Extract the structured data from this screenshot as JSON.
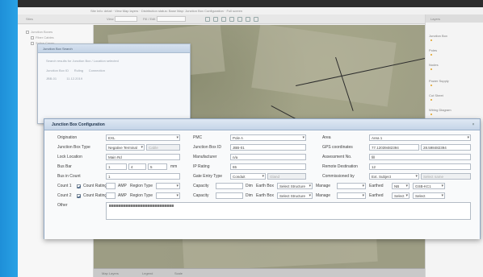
{
  "window": {
    "title_text": "Site Info: detail · View Map layers · Distribution status: Base Map: Junction Box Configuration · Full screen"
  },
  "menubar": {
    "items": [
      "Sites",
      "View",
      "Fill / Edit"
    ]
  },
  "left_panel": {
    "items": [
      "Junction Boxes",
      "Fiber Cables",
      "Splice Cases"
    ]
  },
  "small_dialog": {
    "title": "Junction Box Search",
    "search_text": "Search results for Junction Box / Location selected",
    "columns": [
      "Junction Box ID",
      "Ruling",
      "Connection"
    ],
    "row": [
      "JBB-01",
      "11.12.2019",
      ""
    ]
  },
  "right_panel": {
    "header": "Layers",
    "items": [
      "Junction Box",
      "Poles",
      "Nodes",
      "Power Supply",
      "Cut Sheet",
      "Wiring Diagram"
    ]
  },
  "dialog": {
    "title": "Junction Box Configuration",
    "labels": {
      "origination": "Origination",
      "jb_type": "Junction Box Type",
      "location": "Lock Location",
      "bus_bar": "Bus Bar",
      "bus_count": "Bus in Count",
      "count_row1": "Count 1",
      "count_row2": "Count 2",
      "other": "Other",
      "pmc": "PMC",
      "jb_id": "Junction Box ID",
      "manufacturer": "Manufacturer",
      "ip_rating": "IP Rating",
      "gate_entry_type": "Gate Entry Type",
      "capacity_1": "Capacity",
      "capacity_2": "Capacity",
      "dim_1": "Dim",
      "dim_2": "Dim",
      "earth_box_1": "Earth Box",
      "earth_box_2": "Earth Box",
      "area": "Area",
      "gps": "GPS coordinates",
      "assessment_no": "Assessment No.",
      "remote_destination": "Remote Destination",
      "commissioned_by": "Commissioned by",
      "manage_1": "Manage",
      "manage_2": "Manage",
      "earthed_1": "Earthed",
      "earthed_2": "Earthed",
      "mm": "mm",
      "nnm": "NNM",
      "count_rating": "Count Rating",
      "ampere": "AMP",
      "region_type": "Region Type"
    },
    "values": {
      "origination": "EXL",
      "jb_type": "Negative Terminal",
      "jb_type_extra": "Cable",
      "location": "Main Rd",
      "bus_bar_1": "1",
      "bus_bar_2": "4",
      "bus_bar_3": "5",
      "bus_count": "1",
      "pmc": "Pole A",
      "jb_id": "JBB-01",
      "manufacturer": "n/a",
      "ip_rating": "65",
      "gate_entry_type": "Conduit",
      "gate_entry_extra": "Gland",
      "area": "Area 1",
      "gps_lat": "77.12039482394",
      "gps_lon": "28.598482394",
      "assessment_no": "fill",
      "remote_destination": "12",
      "commissioned_by": "Ext. Subject",
      "commissioned_extra": "Select name",
      "earth_select": "Select Structure",
      "earthed_val": "NB",
      "earthed_code": "GSB-KC1",
      "earthed2_val": "Select",
      "earthed2_code": "Select"
    }
  },
  "bottombar": {
    "items": [
      "Map Layers",
      "Legend",
      "Scale"
    ]
  }
}
